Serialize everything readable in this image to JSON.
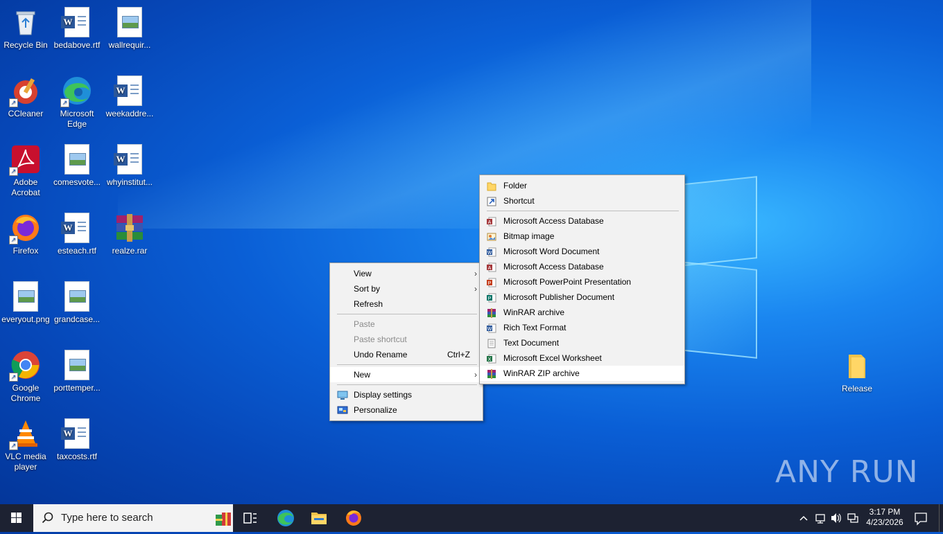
{
  "desktop": {
    "icons": [
      {
        "label": "Recycle Bin",
        "icon": "recycle-bin-icon"
      },
      {
        "label": "bedabove.rtf",
        "icon": "word-doc-icon"
      },
      {
        "label": "wallrequir...",
        "icon": "image-file-icon"
      },
      {
        "label": "CCleaner",
        "icon": "ccleaner-icon"
      },
      {
        "label": "Microsoft Edge",
        "icon": "edge-icon"
      },
      {
        "label": "weekaddre...",
        "icon": "word-doc-icon"
      },
      {
        "label": "Adobe Acrobat",
        "icon": "acrobat-icon"
      },
      {
        "label": "comesvote...",
        "icon": "image-file-icon"
      },
      {
        "label": "whyinstitut...",
        "icon": "word-doc-icon"
      },
      {
        "label": "Firefox",
        "icon": "firefox-icon"
      },
      {
        "label": "esteach.rtf",
        "icon": "word-doc-icon"
      },
      {
        "label": "realze.rar",
        "icon": "winrar-icon"
      },
      {
        "label": "everyout.png",
        "icon": "image-file-icon"
      },
      {
        "label": "grandcase...",
        "icon": "image-file-icon"
      },
      {
        "label": "Google Chrome",
        "icon": "chrome-icon"
      },
      {
        "label": "porttemper...",
        "icon": "image-file-icon"
      },
      {
        "label": "VLC media player",
        "icon": "vlc-icon"
      },
      {
        "label": "taxcosts.rtf",
        "icon": "word-doc-icon"
      },
      {
        "label": "Release",
        "icon": "folder-icon"
      }
    ]
  },
  "context_menu": {
    "items": [
      {
        "label": "View",
        "submenu": true
      },
      {
        "label": "Sort by",
        "submenu": true
      },
      {
        "label": "Refresh"
      },
      {
        "label": "Paste",
        "disabled": true
      },
      {
        "label": "Paste shortcut",
        "disabled": true
      },
      {
        "label": "Undo Rename",
        "shortcut": "Ctrl+Z"
      },
      {
        "label": "New",
        "submenu": true
      },
      {
        "label": "Display settings",
        "icon": "display-settings-icon"
      },
      {
        "label": "Personalize",
        "icon": "personalize-icon"
      }
    ]
  },
  "new_submenu": {
    "items": [
      {
        "label": "Folder",
        "icon": "folder-icon"
      },
      {
        "label": "Shortcut",
        "icon": "shortcut-icon"
      },
      {
        "label": "Microsoft Access Database",
        "icon": "access-icon"
      },
      {
        "label": "Bitmap image",
        "icon": "bitmap-icon"
      },
      {
        "label": "Microsoft Word Document",
        "icon": "word-icon"
      },
      {
        "label": "Microsoft Access Database",
        "icon": "access-icon"
      },
      {
        "label": "Microsoft PowerPoint Presentation",
        "icon": "powerpoint-icon"
      },
      {
        "label": "Microsoft Publisher Document",
        "icon": "publisher-icon"
      },
      {
        "label": "WinRAR archive",
        "icon": "winrar-icon"
      },
      {
        "label": "Rich Text Format",
        "icon": "wordpad-icon"
      },
      {
        "label": "Text Document",
        "icon": "text-document-icon"
      },
      {
        "label": "Microsoft Excel Worksheet",
        "icon": "excel-icon"
      },
      {
        "label": "WinRAR ZIP archive",
        "icon": "winrar-zip-icon"
      }
    ]
  },
  "taskbar": {
    "search_placeholder": "Type here to search",
    "time": "3:17 PM",
    "date": "4/23/2026"
  },
  "watermark": "ANY RUN",
  "colors": {
    "taskbar": "#1d2232",
    "menu_bg": "#f2f2f2",
    "desktop_accent": "#0a5fd6"
  }
}
